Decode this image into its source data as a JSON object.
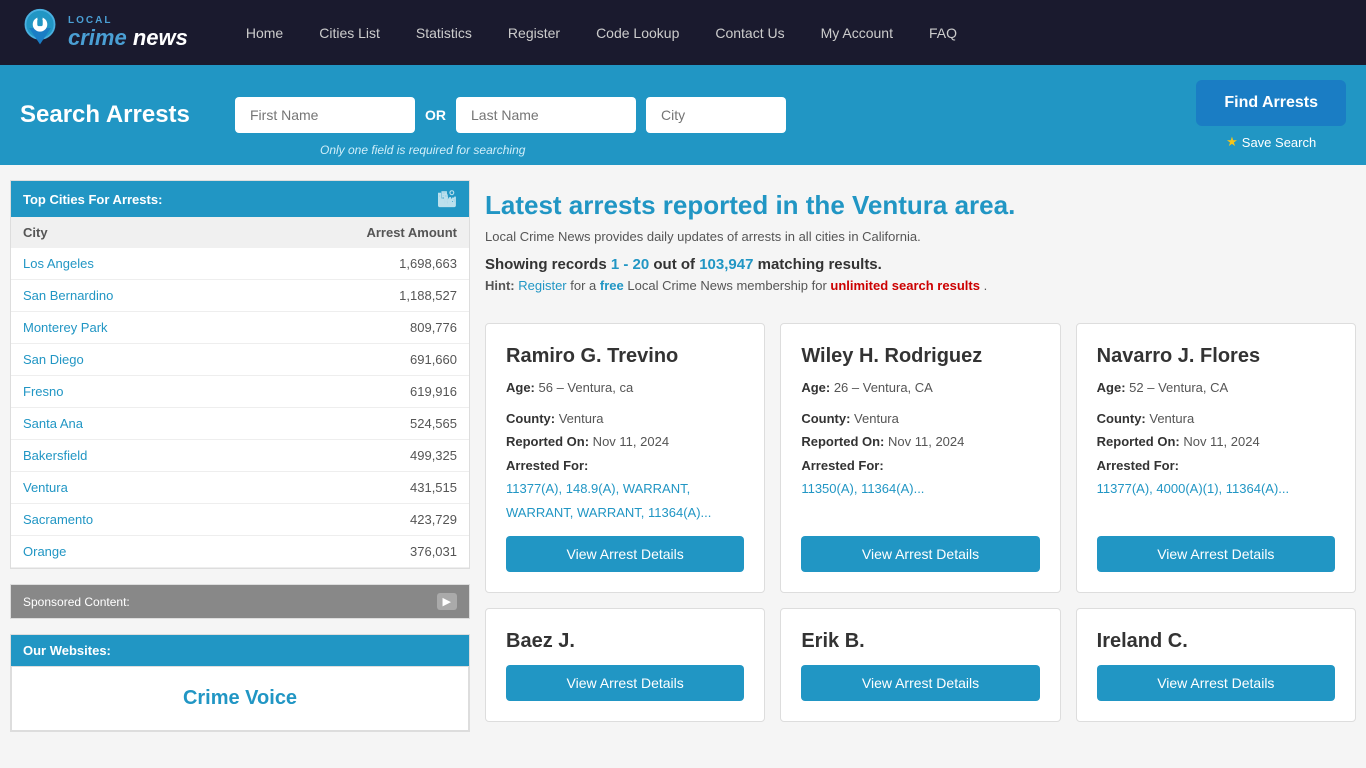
{
  "nav": {
    "links": [
      {
        "label": "Home",
        "href": "#"
      },
      {
        "label": "Cities List",
        "href": "#"
      },
      {
        "label": "Statistics",
        "href": "#"
      },
      {
        "label": "Register",
        "href": "#"
      },
      {
        "label": "Code Lookup",
        "href": "#"
      },
      {
        "label": "Contact Us",
        "href": "#"
      },
      {
        "label": "My Account",
        "href": "#"
      },
      {
        "label": "FAQ",
        "href": "#"
      }
    ]
  },
  "search": {
    "label": "Search Arrests",
    "first_name_placeholder": "First Name",
    "last_name_placeholder": "Last Name",
    "city_placeholder": "City",
    "or_label": "OR",
    "hint": "Only one field is required for searching",
    "find_btn": "Find Arrests",
    "save_btn": "Save Search"
  },
  "sidebar": {
    "top_cities_header": "Top Cities For Arrests:",
    "col_city": "City",
    "col_amount": "Arrest Amount",
    "cities": [
      {
        "name": "Los Angeles",
        "amount": "1,698,663"
      },
      {
        "name": "San Bernardino",
        "amount": "1,188,527"
      },
      {
        "name": "Monterey Park",
        "amount": "809,776"
      },
      {
        "name": "San Diego",
        "amount": "691,660"
      },
      {
        "name": "Fresno",
        "amount": "619,916"
      },
      {
        "name": "Santa Ana",
        "amount": "524,565"
      },
      {
        "name": "Bakersfield",
        "amount": "499,325"
      },
      {
        "name": "Ventura",
        "amount": "431,515"
      },
      {
        "name": "Sacramento",
        "amount": "423,729"
      },
      {
        "name": "Orange",
        "amount": "376,031"
      }
    ],
    "sponsored_label": "Sponsored Content:",
    "our_websites_label": "Our Websites:",
    "crime_voice_label": "Crime Voice"
  },
  "content": {
    "title": "Latest arrests reported in the Ventura area.",
    "subtitle": "Local Crime News provides daily updates of arrests in all cities in California.",
    "showing_prefix": "Showing records ",
    "showing_range": "1 - 20",
    "showing_middle": " out of ",
    "showing_count": "103,947",
    "showing_suffix": " matching results.",
    "hint_prefix": "Hint: ",
    "hint_register": "Register",
    "hint_middle": " for a ",
    "hint_free": "free",
    "hint_text": " Local Crime News membership for ",
    "hint_unlimited": "unlimited search results",
    "hint_end": ".",
    "cards": [
      {
        "name": "Ramiro G. Trevino",
        "age": "56",
        "location": "Ventura, ca",
        "county": "Ventura",
        "reported": "Nov 11, 2024",
        "charges": "11377(A), 148.9(A), WARRANT, WARRANT, WARRANT, 11364(A)...",
        "btn": "View Arrest Details"
      },
      {
        "name": "Wiley H. Rodriguez",
        "age": "26",
        "location": "Ventura, CA",
        "county": "Ventura",
        "reported": "Nov 11, 2024",
        "charges": "11350(A), 11364(A)...",
        "btn": "View Arrest Details"
      },
      {
        "name": "Navarro J. Flores",
        "age": "52",
        "location": "Ventura, CA",
        "county": "Ventura",
        "reported": "Nov 11, 2024",
        "charges": "11377(A), 4000(A)(1), 11364(A)...",
        "btn": "View Arrest Details"
      },
      {
        "name": "Baez J.",
        "age": "",
        "location": "",
        "county": "",
        "reported": "",
        "charges": "",
        "btn": "View Arrest Details"
      },
      {
        "name": "Erik B.",
        "age": "",
        "location": "",
        "county": "",
        "reported": "",
        "charges": "",
        "btn": "View Arrest Details"
      },
      {
        "name": "Ireland C.",
        "age": "",
        "location": "",
        "county": "",
        "reported": "",
        "charges": "",
        "btn": "View Arrest Details"
      }
    ]
  }
}
